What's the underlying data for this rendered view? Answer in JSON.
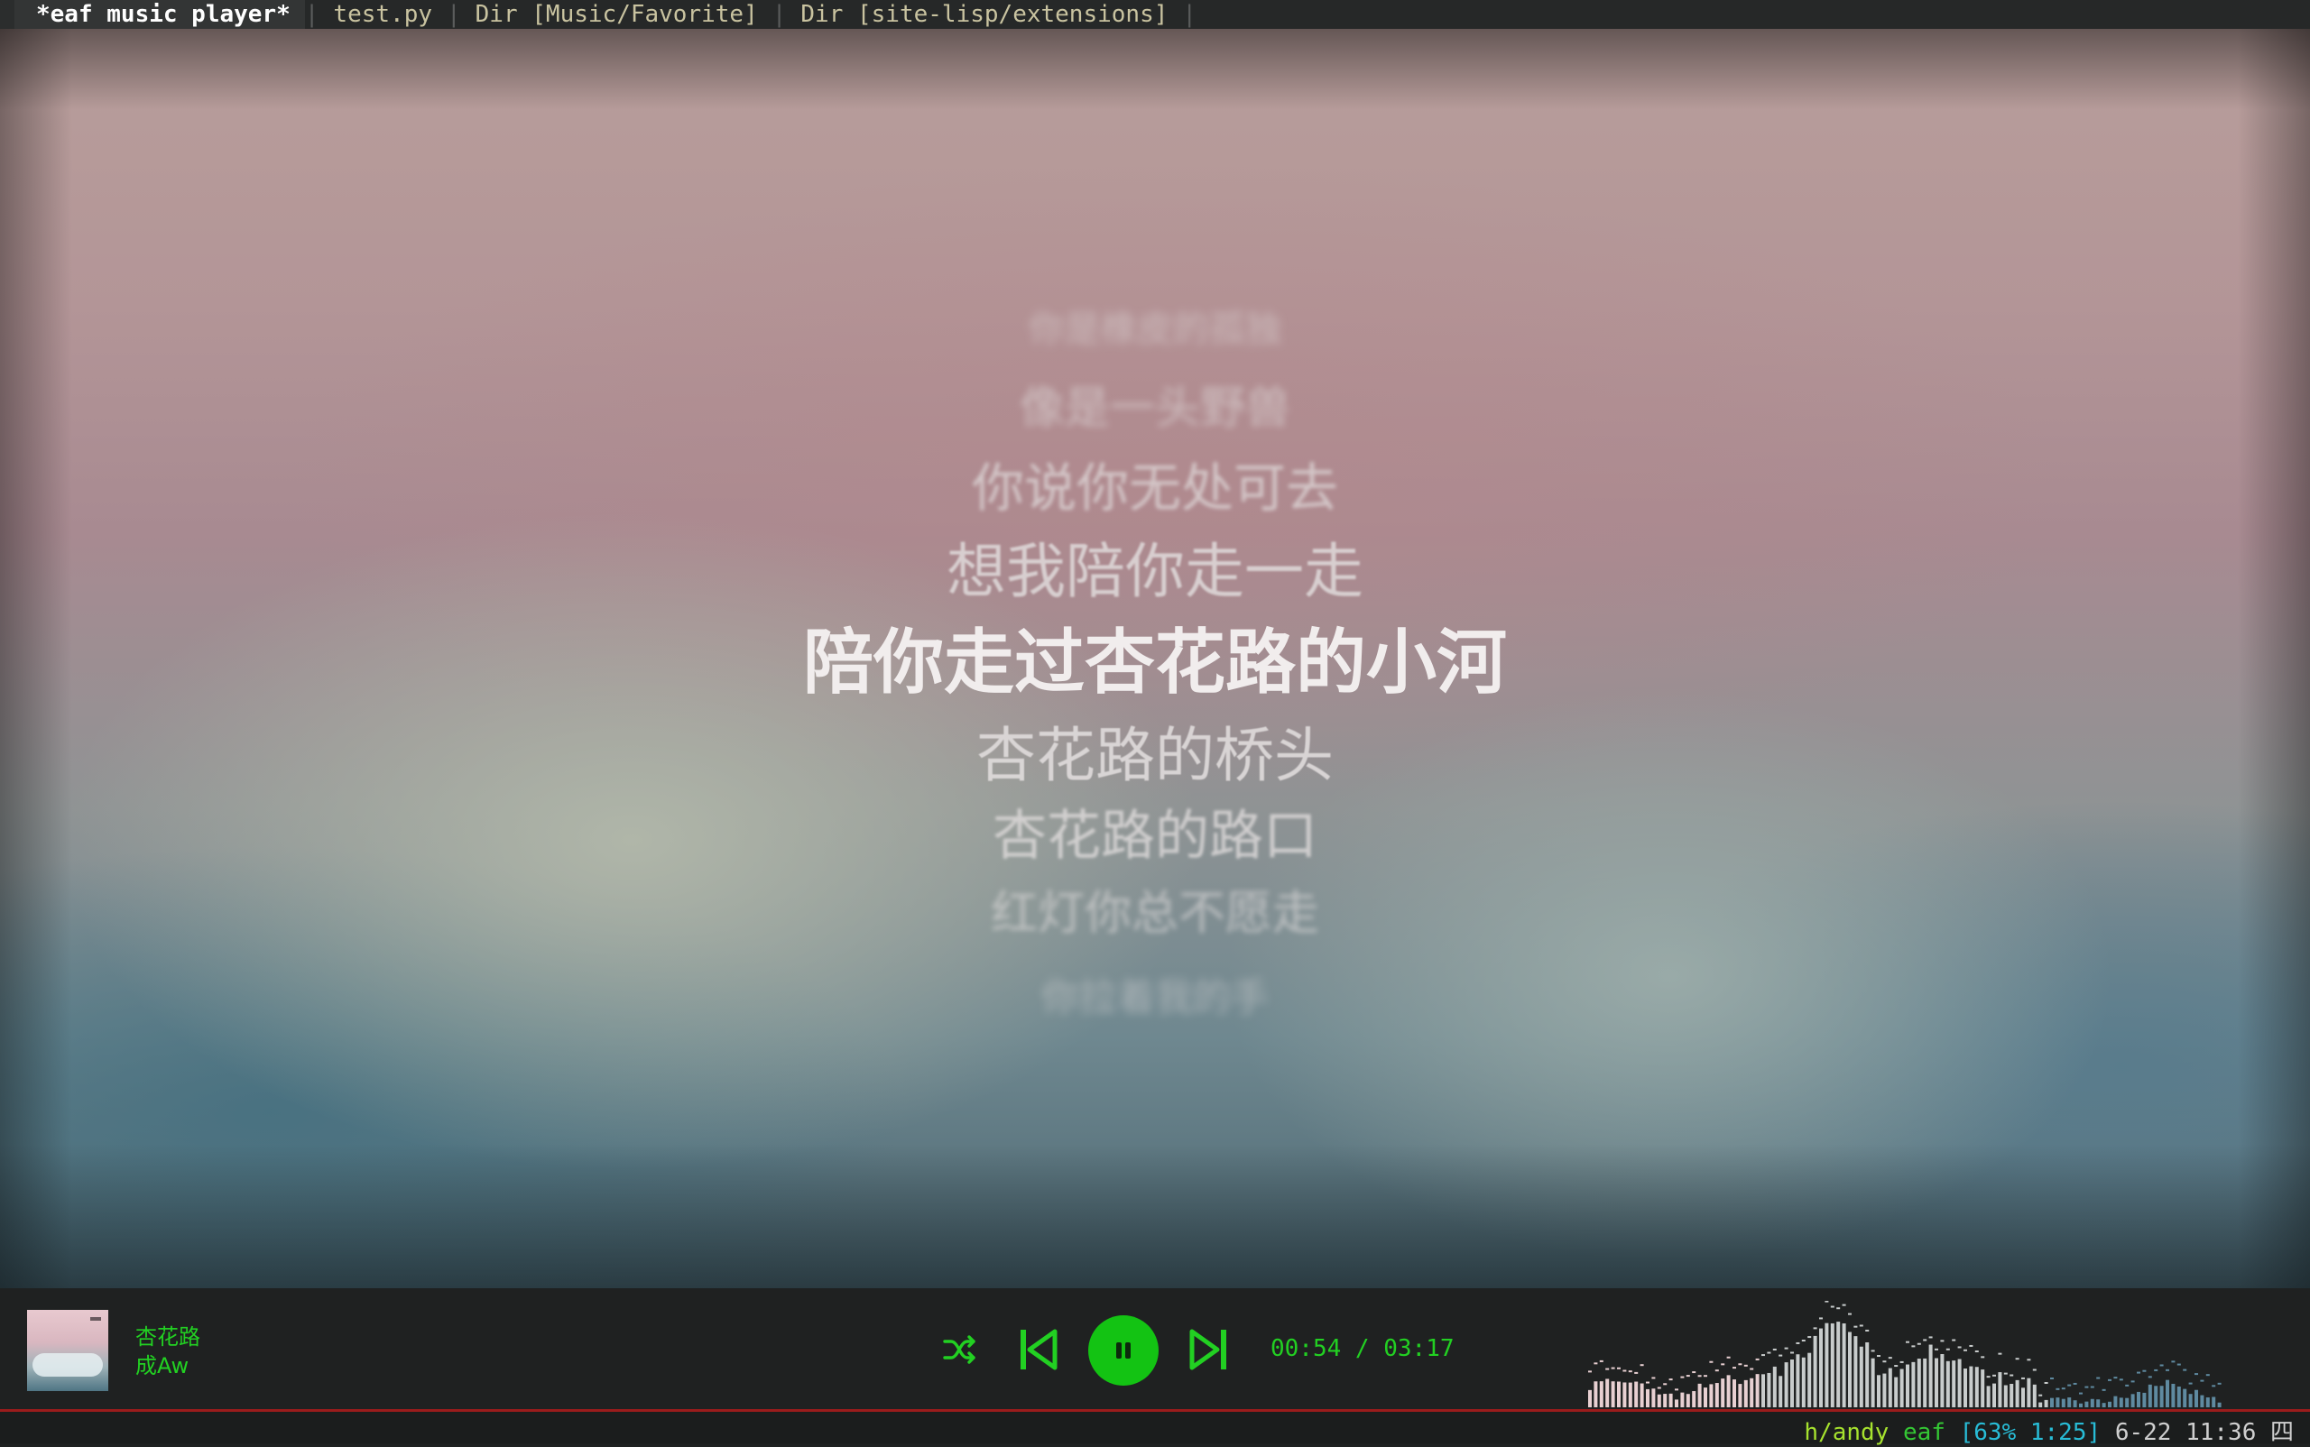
{
  "tabbar": {
    "tabs": [
      {
        "label": "*eaf music player*",
        "active": true
      },
      {
        "label": "test.py"
      },
      {
        "label": "Dir [Music/Favorite]"
      },
      {
        "label": "Dir [site-lisp/extensions]"
      }
    ],
    "separator": "|"
  },
  "lyrics": {
    "lines": [
      "你是橡皮的孤独",
      "像是一头野兽",
      "你说你无处可去",
      "想我陪你走一走",
      "陪你走过杏花路的小河",
      "杏花路的桥头",
      "杏花路的路口",
      "红灯你总不愿走",
      "你拉着我的手"
    ],
    "current_index": 4
  },
  "player": {
    "title": "杏花路",
    "artist": "成Aw",
    "current_time": "00:54",
    "total_time": "03:17",
    "time_separator": " / ",
    "progress_fraction": 0.274,
    "state": "playing",
    "icons": {
      "shuffle": "shuffle-icon",
      "prev": "skip-previous-icon",
      "play_pause": "pause-icon",
      "next": "skip-next-icon"
    },
    "accent_color": "#13c313"
  },
  "modeline": {
    "path": "h/andy",
    "mode": "eaf",
    "position": "[63% 1:25]",
    "datetime": "6-22 11:36 四",
    "border_color": "#9b1c1c"
  }
}
